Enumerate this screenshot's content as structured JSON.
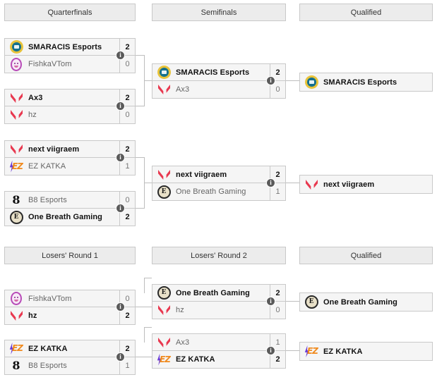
{
  "bracket": {
    "upper": {
      "headers": [
        {
          "label": "Quarterfinals"
        },
        {
          "label": "Semifinals"
        },
        {
          "label": "Qualified"
        }
      ],
      "quarterfinals": [
        {
          "info": "i",
          "top": {
            "team": "SMARACIS Esports",
            "score": "2",
            "logo": "smaracis",
            "winner": true
          },
          "bottom": {
            "team": "FishkaVTom",
            "score": "0",
            "logo": "fishka",
            "winner": false
          }
        },
        {
          "info": "i",
          "top": {
            "team": "Ax3",
            "score": "2",
            "logo": "valorant",
            "winner": true
          },
          "bottom": {
            "team": "hz",
            "score": "0",
            "logo": "valorant",
            "winner": false
          }
        },
        {
          "info": "i",
          "top": {
            "team": "next viigraem",
            "score": "2",
            "logo": "valorant",
            "winner": true
          },
          "bottom": {
            "team": "EZ KATKA",
            "score": "1",
            "logo": "ez",
            "winner": false
          }
        },
        {
          "info": "i",
          "top": {
            "team": "B8 Esports",
            "score": "0",
            "logo": "b8",
            "winner": false
          },
          "bottom": {
            "team": "One Breath Gaming",
            "score": "2",
            "logo": "obg",
            "winner": true
          }
        }
      ],
      "semifinals": [
        {
          "info": "i",
          "top": {
            "team": "SMARACIS Esports",
            "score": "2",
            "logo": "smaracis",
            "winner": true
          },
          "bottom": {
            "team": "Ax3",
            "score": "0",
            "logo": "valorant",
            "winner": false
          }
        },
        {
          "info": "i",
          "top": {
            "team": "next viigraem",
            "score": "2",
            "logo": "valorant",
            "winner": true
          },
          "bottom": {
            "team": "One Breath Gaming",
            "score": "1",
            "logo": "obg",
            "winner": false
          }
        }
      ],
      "qualified": [
        {
          "team": "SMARACIS Esports",
          "logo": "smaracis"
        },
        {
          "team": "next viigraem",
          "logo": "valorant"
        }
      ]
    },
    "lower": {
      "headers": [
        {
          "label": "Losers' Round 1"
        },
        {
          "label": "Losers' Round 2"
        },
        {
          "label": "Qualified"
        }
      ],
      "losers_round_1": [
        {
          "info": "i",
          "top": {
            "team": "FishkaVTom",
            "score": "0",
            "logo": "fishka",
            "winner": false
          },
          "bottom": {
            "team": "hz",
            "score": "2",
            "logo": "valorant",
            "winner": true
          }
        },
        {
          "info": "i",
          "top": {
            "team": "EZ KATKA",
            "score": "2",
            "logo": "ez",
            "winner": true
          },
          "bottom": {
            "team": "B8 Esports",
            "score": "1",
            "logo": "b8",
            "winner": false
          }
        }
      ],
      "losers_round_2": [
        {
          "info": "i",
          "top": {
            "team": "One Breath Gaming",
            "score": "2",
            "logo": "obg",
            "winner": true
          },
          "bottom": {
            "team": "hz",
            "score": "0",
            "logo": "valorant",
            "winner": false
          }
        },
        {
          "info": "i",
          "top": {
            "team": "Ax3",
            "score": "1",
            "logo": "valorant",
            "winner": false
          },
          "bottom": {
            "team": "EZ KATKA",
            "score": "2",
            "logo": "ez",
            "winner": true
          }
        }
      ],
      "qualified": [
        {
          "team": "One Breath Gaming",
          "logo": "obg"
        },
        {
          "team": "EZ KATKA",
          "logo": "ez"
        }
      ]
    }
  },
  "colors": {
    "header_bg": "#ececec",
    "border": "#c9c9c9",
    "row_bg": "#f5f5f5",
    "connector": "#bdbdbd",
    "info_badge": "#5a5a5a",
    "valorant_red": "#e8384f",
    "smaracis_gold": "#e8c33a",
    "smaracis_teal": "#14708e",
    "fishka_purple": "#b84bb8",
    "ez_purple": "#6a3bd6",
    "ez_orange": "#f08a1e"
  },
  "icons": {
    "info": "info-circle-icon"
  }
}
